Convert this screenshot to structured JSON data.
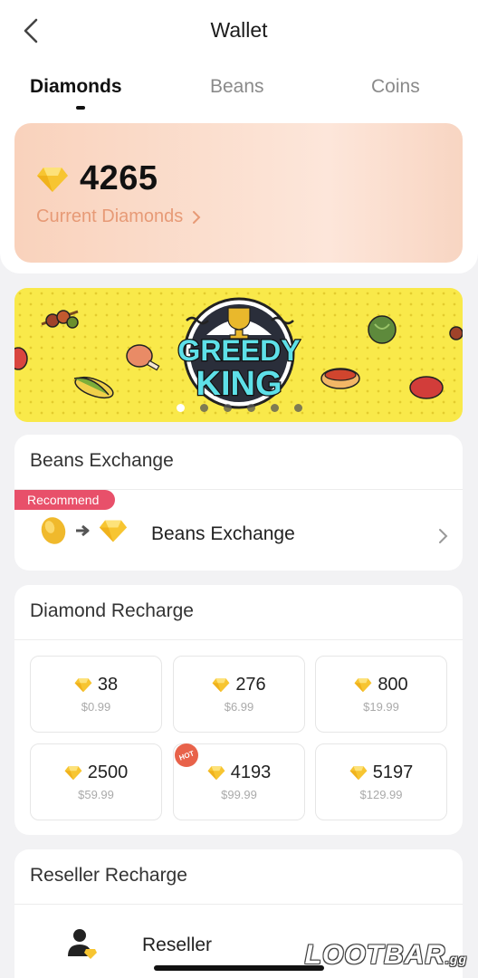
{
  "header": {
    "title": "Wallet",
    "back_icon": "chevron-left-icon"
  },
  "tabs": [
    {
      "label": "Diamonds",
      "active": true
    },
    {
      "label": "Beans",
      "active": false
    },
    {
      "label": "Coins",
      "active": false
    }
  ],
  "balance": {
    "amount": "4265",
    "label": "Current Diamonds",
    "link_icon": "chevron-right-icon"
  },
  "banner": {
    "title_line1": "GREEDY",
    "title_line2": "KING",
    "page_count": 6,
    "active_page": 1
  },
  "beans_exchange": {
    "title": "Beans Exchange",
    "badge": "Recommend",
    "row_label": "Beans Exchange"
  },
  "diamond_recharge": {
    "title": "Diamond Recharge",
    "packs": [
      {
        "amount": "38",
        "price": "$0.99",
        "hot": false
      },
      {
        "amount": "276",
        "price": "$6.99",
        "hot": false
      },
      {
        "amount": "800",
        "price": "$19.99",
        "hot": false
      },
      {
        "amount": "2500",
        "price": "$59.99",
        "hot": false
      },
      {
        "amount": "4193",
        "price": "$99.99",
        "hot": true
      },
      {
        "amount": "5197",
        "price": "$129.99",
        "hot": false
      }
    ],
    "hot_badge": "HOT"
  },
  "reseller": {
    "title": "Reseller Recharge",
    "row_label": "Reseller"
  },
  "watermark": {
    "text": "LOOTBAR",
    "suffix": ".gg"
  },
  "colors": {
    "accent_pink": "#e8506a",
    "diamond_yellow": "#f7c531",
    "banner_yellow": "#f9e94a",
    "link_orange": "#e79a76"
  }
}
